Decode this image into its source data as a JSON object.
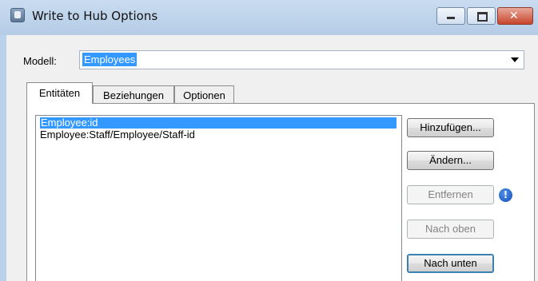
{
  "window": {
    "title": "Write to Hub Options",
    "icons": {
      "app": "app-icon",
      "minimize": "minimize-icon",
      "maximize": "maximize-icon",
      "close": "close-icon"
    }
  },
  "model": {
    "label": "Modell:",
    "value": "Employees",
    "dropdown_icon": "chevron-down-icon"
  },
  "tabs": [
    {
      "label": "Entitäten",
      "active": true
    },
    {
      "label": "Beziehungen",
      "active": false
    },
    {
      "label": "Optionen",
      "active": false
    }
  ],
  "entities": [
    {
      "label": "Employee:id",
      "selected": true
    },
    {
      "label": "Employee:Staff/Employee/Staff-id",
      "selected": false
    }
  ],
  "buttons": {
    "add": "Hinzufügen...",
    "edit": "Ändern...",
    "remove": "Entfernen",
    "move_up": "Nach oben",
    "move_down": "Nach unten"
  },
  "info_icon": {
    "name": "info-icon",
    "glyph": "!"
  },
  "colors": {
    "selection": "#3399ff",
    "titlebar": "#b9d1ea",
    "close": "#c7452c"
  }
}
